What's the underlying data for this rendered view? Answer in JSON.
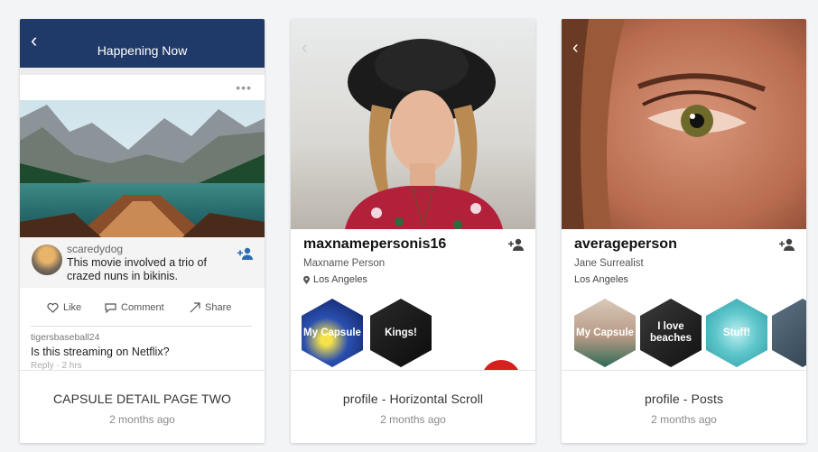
{
  "cards": [
    {
      "screen": {
        "header_title": "Happening Now",
        "post": {
          "menu": "•••",
          "username": "scaredydog",
          "text": "This movie involved a trio of crazed nuns in bikinis.",
          "actions": {
            "like": "Like",
            "comment": "Comment",
            "share": "Share"
          },
          "comment": {
            "username": "tigersbaseball24",
            "text": "Is this streaming on Netflix?",
            "meta": "Reply · 2 hrs"
          }
        }
      },
      "title": "CAPSULE DETAIL PAGE TWO",
      "time": "2 months ago"
    },
    {
      "screen": {
        "username": "maxnamepersonis16",
        "real_name": "Maxname Person",
        "location": "Los Angeles",
        "capsules": [
          "My Capsule",
          "Kings!"
        ]
      },
      "title": "profile - Horizontal Scroll",
      "time": "2 months ago"
    },
    {
      "screen": {
        "username": "averageperson",
        "real_name": "Jane Surrealist",
        "location": "Los Angeles",
        "capsules": [
          "My Capsule",
          "I love beaches",
          "Stuff!",
          ""
        ]
      },
      "title": "profile - Posts",
      "time": "2 months ago"
    }
  ],
  "colors": {
    "header": "#1f3a68",
    "accent_blue": "#2e6bb4",
    "fab_red": "#d61f1f"
  },
  "icons": [
    "back-chevron-icon",
    "more-dots-icon",
    "add-person-icon",
    "heart-icon",
    "comment-icon",
    "share-icon",
    "location-pin-icon"
  ]
}
